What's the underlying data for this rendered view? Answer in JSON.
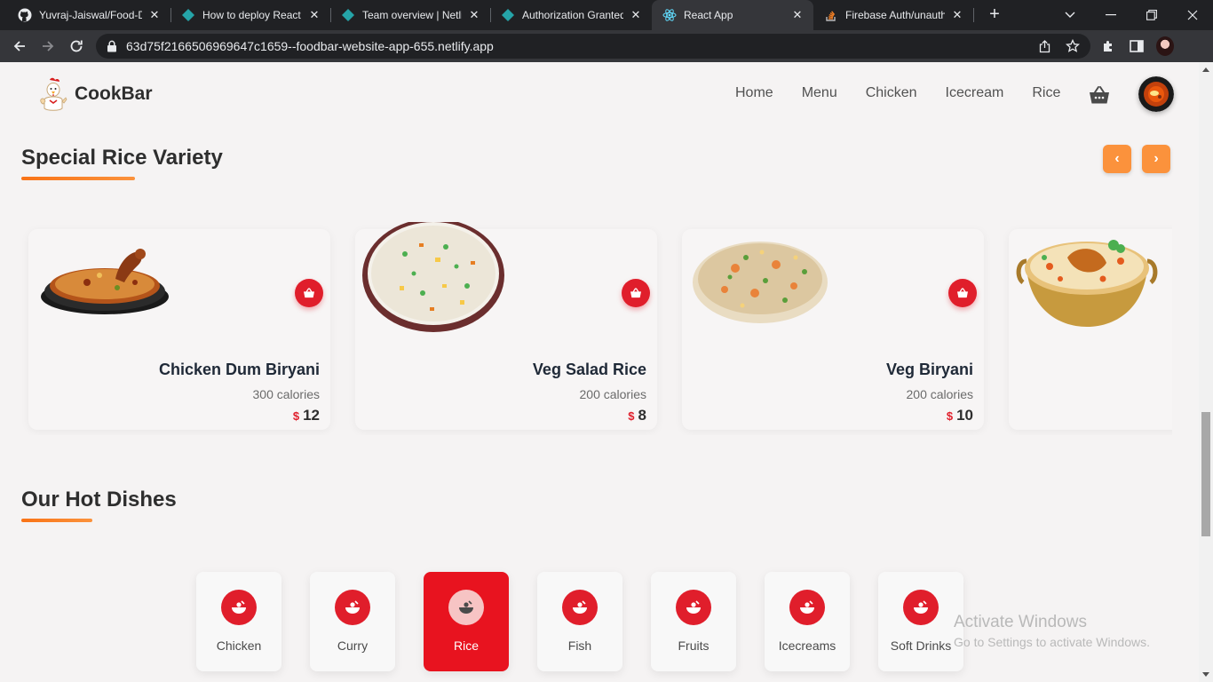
{
  "browser": {
    "tabs": [
      {
        "label": "Yuvraj-Jaiswal/Food-D",
        "icon": "github-icon"
      },
      {
        "label": "How to deploy React A",
        "icon": "netlify-icon"
      },
      {
        "label": "Team overview | Netlif",
        "icon": "netlify-icon"
      },
      {
        "label": "Authorization Granted",
        "icon": "netlify-icon"
      },
      {
        "label": "React App",
        "icon": "react-icon",
        "active": true
      },
      {
        "label": "Firebase Auth/unauth",
        "icon": "stackoverflow-icon"
      }
    ],
    "close_glyph": "✕",
    "new_tab_glyph": "+",
    "url": "63d75f2166506969647c1659--foodbar-website-app-655.netlify.app"
  },
  "site": {
    "brand": "CookBar",
    "nav": [
      "Home",
      "Menu",
      "Chicken",
      "Icecream",
      "Rice"
    ]
  },
  "rice_section": {
    "title": "Special Rice Variety",
    "prev_glyph": "‹",
    "next_glyph": "›",
    "items": [
      {
        "name": "Chicken Dum Biryani",
        "calories": "300 calories",
        "currency": "$",
        "price": "12"
      },
      {
        "name": "Veg Salad Rice",
        "calories": "200 calories",
        "currency": "$",
        "price": "8"
      },
      {
        "name": "Veg Biryani",
        "calories": "200 calories",
        "currency": "$",
        "price": "10"
      }
    ]
  },
  "hot_dishes": {
    "title": "Our Hot Dishes",
    "categories": [
      "Chicken",
      "Curry",
      "Rice",
      "Fish",
      "Fruits",
      "Icecreams",
      "Soft Drinks"
    ],
    "active": "Rice"
  },
  "watermark": {
    "line1": "Activate Windows",
    "line2": "Go to Settings to activate Windows."
  },
  "colors": {
    "accent_orange": "#fb923c",
    "accent_red": "#e01e2b",
    "chrome_dark": "#202124"
  }
}
